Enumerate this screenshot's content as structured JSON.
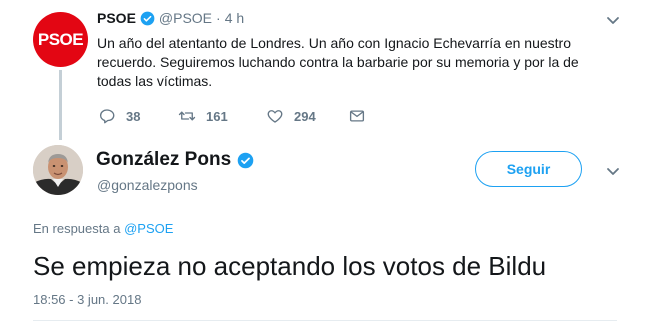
{
  "parent_tweet": {
    "avatar_text": "PSOE",
    "name": "PSOE",
    "handle": "@PSOE",
    "separator": "·",
    "time": "4 h",
    "text": "Un año del atentanto de Londres. Un año con Ignacio Echevarría en nuestro recuerdo. Seguiremos luchando contra la barbarie por su memoria y por la de todas las víctimas.",
    "actions": {
      "replies": "38",
      "retweets": "161",
      "likes": "294"
    }
  },
  "main_tweet": {
    "name": "González Pons",
    "handle": "@gonzalezpons",
    "follow_label": "Seguir",
    "reply_prefix": "En respuesta a",
    "reply_to": "@PSOE",
    "text": "Se empieza no aceptando los votos de Bildu",
    "timestamp": "18:56 - 3 jun. 2018"
  },
  "colors": {
    "accent": "#1da1f2",
    "psoe_red": "#e30613",
    "muted": "#657786"
  },
  "icons": [
    "verified-icon",
    "chevron-down-icon",
    "reply-icon",
    "retweet-icon",
    "heart-icon",
    "envelope-icon"
  ]
}
